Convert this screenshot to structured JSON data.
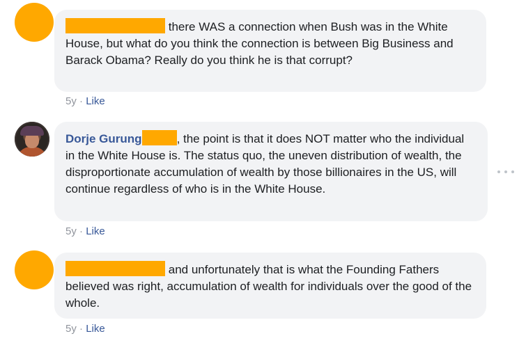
{
  "comments": [
    {
      "author": "",
      "text": "there WAS a connection when Bush was in the White House, but what do you think the connection is between Big Business and Barack Obama? Really do you think he is that corrupt?",
      "age": "5y",
      "separator": "·",
      "like_label": "Like"
    },
    {
      "author": "Dorje Gurung",
      "text": ", the point is that it does NOT matter who the individual in the White House is. The status quo, the uneven distribution of wealth, the disproportionate accumulation of wealth by those billionaires in the US, will continue regardless of who is in the White House.",
      "age": "5y",
      "separator": "·",
      "like_label": "Like"
    },
    {
      "author": "",
      "text": "and unfortunately that is what the Founding Fathers believed was right, accumulation of wealth for individuals over the good of the whole.",
      "age": "5y",
      "separator": "·",
      "like_label": "Like"
    }
  ],
  "colors": {
    "redaction": "#ffa800",
    "bubble": "#f2f3f5",
    "link": "#385898",
    "meta": "#90949c"
  },
  "icons": {
    "more_options": "more-options-icon"
  }
}
